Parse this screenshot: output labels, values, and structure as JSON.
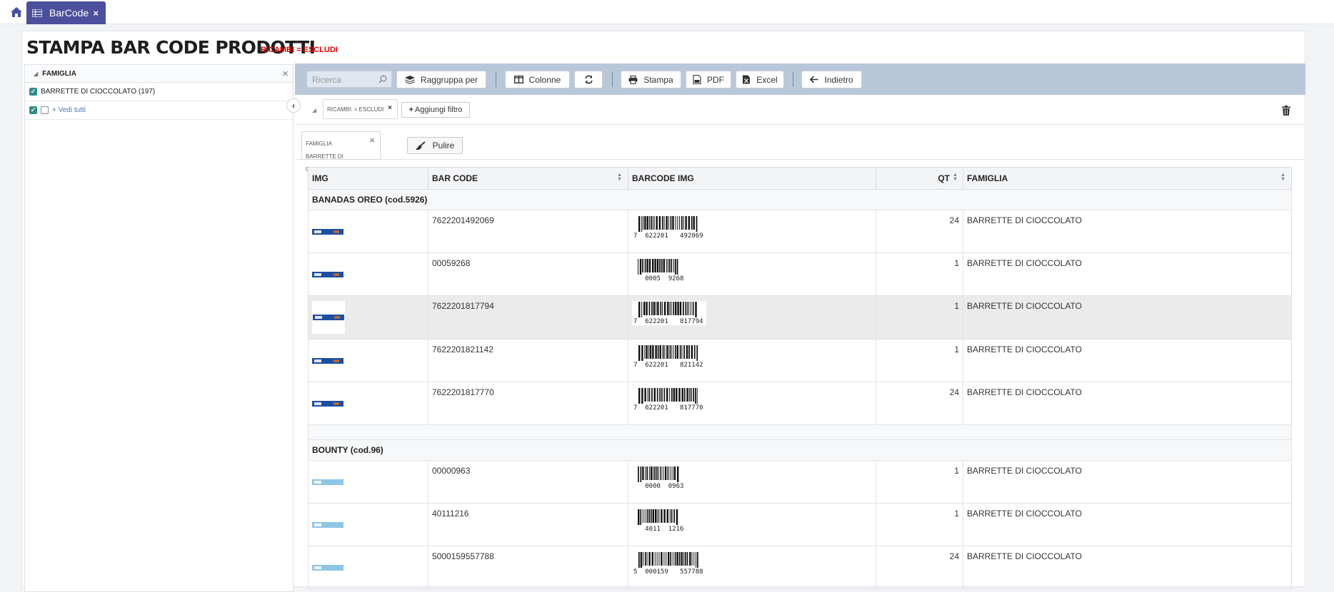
{
  "topbar": {
    "tab_label": "BarCode",
    "tab_close": "×"
  },
  "page": {
    "title": "STAMPA BAR CODE PRODOTTI",
    "subtitle": "RICAMBI = ESCLUDI"
  },
  "left_panel": {
    "header": "FAMIGLIA",
    "close": "×",
    "items": [
      {
        "label": "BARRETTE DI CIOCCOLATO (197)",
        "checked": true
      }
    ],
    "see_all": "+ Vedi tutti"
  },
  "toolbar": {
    "search_placeholder": "Ricerca",
    "group_by": "Raggruppa per",
    "columns": "Colonne",
    "print": "Stampa",
    "pdf": "PDF",
    "excel": "Excel",
    "back": "Indietro"
  },
  "filters": {
    "chip": "RICAMBI: = ESCLUDI",
    "chip_close": "×",
    "add_filter": "Aggiungi filtro"
  },
  "grouping": {
    "chip_title": "FAMIGLIA",
    "chip_value": "BARRETTE DI CIOCCOLATO",
    "chip_close": "×",
    "clean": "Pulire"
  },
  "table": {
    "columns": [
      "IMG",
      "BAR CODE",
      "BARCODE IMG",
      "QT",
      "FAMIGLIA"
    ],
    "groups": [
      {
        "title": "BANADAS OREO (cod.5926)",
        "rows": [
          {
            "barcode": "7622201492069",
            "barcode_text": "7  622201   492069",
            "qt": "24",
            "famiglia": "BARRETTE DI CIOCCOLATO",
            "highlighted": false
          },
          {
            "barcode": "00059268",
            "barcode_text": "   0005  9268",
            "qt": "1",
            "famiglia": "BARRETTE DI CIOCCOLATO",
            "highlighted": false
          },
          {
            "barcode": "7622201817794",
            "barcode_text": "7  622201   817794",
            "qt": "1",
            "famiglia": "BARRETTE DI CIOCCOLATO",
            "highlighted": true
          },
          {
            "barcode": "7622201821142",
            "barcode_text": "7  622201   821142",
            "qt": "1",
            "famiglia": "BARRETTE DI CIOCCOLATO",
            "highlighted": false
          },
          {
            "barcode": "7622201817770",
            "barcode_text": "7  622201   817770",
            "qt": "24",
            "famiglia": "BARRETTE DI CIOCCOLATO",
            "highlighted": false
          }
        ]
      },
      {
        "title": "BOUNTY (cod.96)",
        "rows": [
          {
            "barcode": "00000963",
            "barcode_text": "   0000  0963",
            "qt": "1",
            "famiglia": "BARRETTE DI CIOCCOLATO",
            "highlighted": false
          },
          {
            "barcode": "40111216",
            "barcode_text": "   4011  1216",
            "qt": "1",
            "famiglia": "BARRETTE DI CIOCCOLATO",
            "highlighted": false
          },
          {
            "barcode": "5000159557788",
            "barcode_text": "5  000159   557788",
            "qt": "24",
            "famiglia": "BARRETTE DI CIOCCOLATO",
            "highlighted": false
          }
        ]
      }
    ]
  },
  "colors": {
    "tab_bg": "#4b4f9c",
    "toolbar_bg": "#b9c7da",
    "subtitle_red": "#e00000",
    "oreo_blue": "#1d4fa0",
    "bounty_blue": "#8ec6e6",
    "checkbox_teal": "#2f8f86",
    "link_blue": "#4a78b5"
  },
  "icons": {
    "home": "home-icon",
    "tab": "grid-icon",
    "search": "search-icon",
    "group_by": "layers-icon",
    "columns": "columns-icon",
    "refresh": "refresh-icon",
    "print": "printer-icon",
    "pdf": "pdf-file-icon",
    "excel": "excel-file-icon",
    "back": "arrow-left-icon",
    "trash": "trash-icon",
    "clean": "broom-icon",
    "collapse": "chevron-left-icon"
  }
}
